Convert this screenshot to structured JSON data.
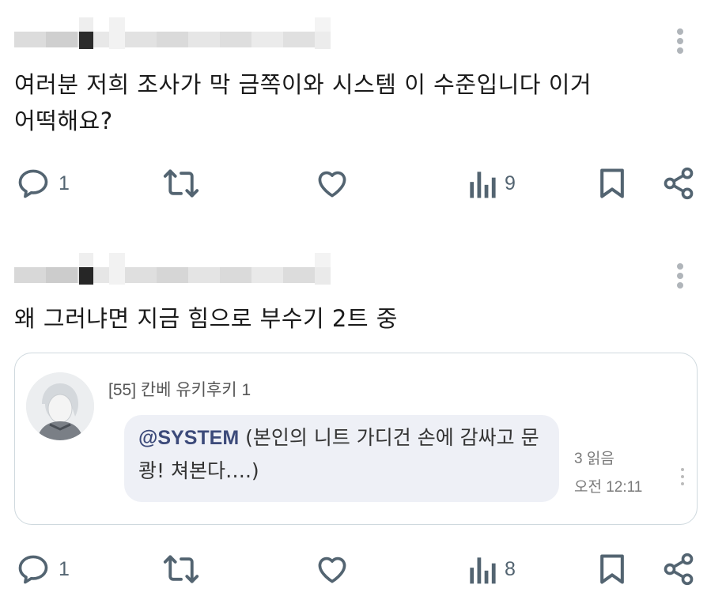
{
  "posts": [
    {
      "text": "여러분 저희 조사가 막 금쪽이와 시스템 이 수준입니다 이거\n어떡해요?",
      "actions": {
        "replies": "1",
        "retweets": "",
        "likes": "",
        "views": "9"
      }
    },
    {
      "text": "왜 그러냐면 지금 힘으로 부수기 2트 중",
      "actions": {
        "replies": "1",
        "retweets": "",
        "likes": "",
        "views": "8"
      },
      "card": {
        "chat_name": "[55] 칸베 유키후키 1",
        "mention": "@SYSTEM",
        "message": " (본인의 니트 가디건 손에 감싸고 문 쾅! 쳐본다….)",
        "read_count": "3 읽음",
        "time": "오전 12:11"
      }
    }
  ],
  "icons": {
    "reply": "reply-bubble-icon",
    "retweet": "retweet-icon",
    "like": "heart-icon",
    "views": "analytics-bars-icon",
    "bookmark": "bookmark-icon",
    "share": "share-icon",
    "more": "more-vertical-icon"
  },
  "colors": {
    "icon": "#536471",
    "bubble": "#eef0f6",
    "mention": "#3c4a7a"
  }
}
